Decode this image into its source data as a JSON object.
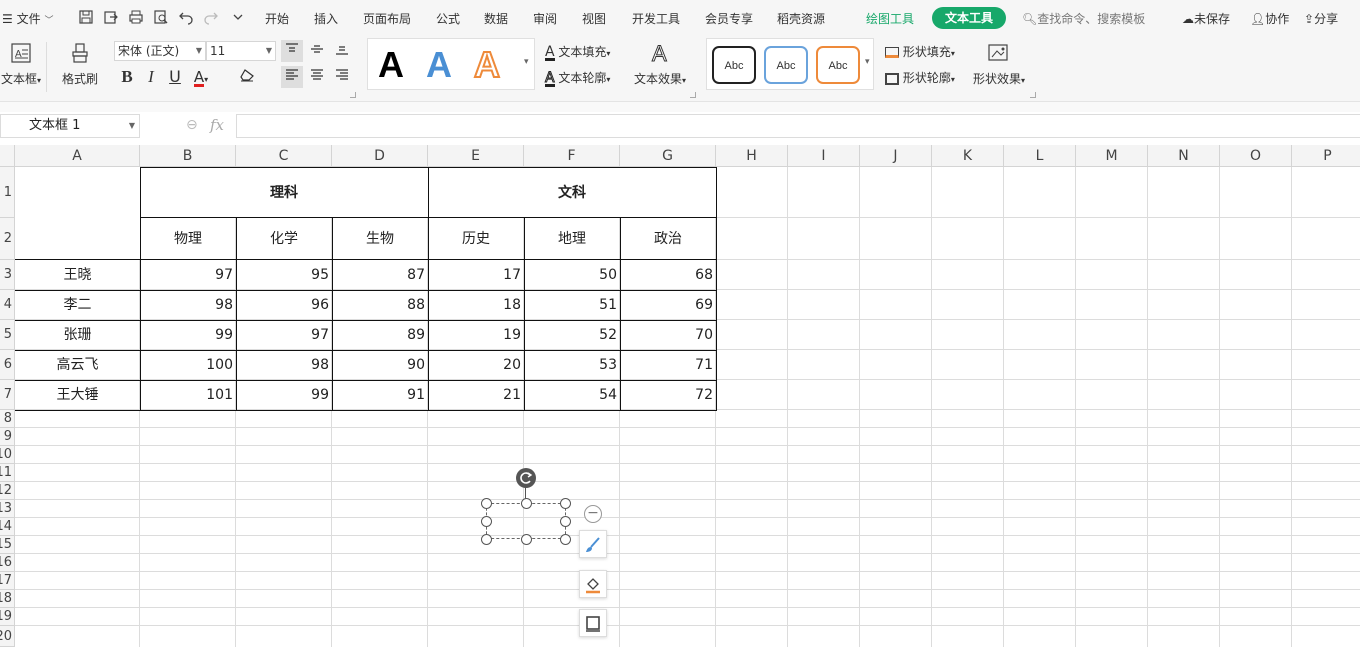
{
  "menu": {
    "file": "文件",
    "tabs": [
      "开始",
      "插入",
      "页面布局",
      "公式",
      "数据",
      "审阅",
      "视图",
      "开发工具",
      "会员专享",
      "稻壳资源"
    ],
    "ctx_draw": "绘图工具",
    "ctx_text": "文本工具",
    "search_placeholder": "查找命令、搜索模板",
    "unsaved": "未保存",
    "collab": "协作",
    "share": "分享"
  },
  "ribbon": {
    "textbox": "文本框",
    "format_painter": "格式刷",
    "font_name": "宋体 (正文)",
    "font_size": "11",
    "bold": "B",
    "italic": "I",
    "underline": "U",
    "fontcolor": "A",
    "style_letter": "A",
    "text_fill": "文本填充",
    "text_outline": "文本轮廓",
    "text_effects": "文本效果",
    "abc": "Abc",
    "shape_fill": "形状填充",
    "shape_outline": "形状轮廓",
    "shape_effects": "形状效果",
    "accent_blue": "#4a8fd4",
    "accent_orange": "#ee8a3a",
    "accent_green": "#17a86a"
  },
  "formula_bar": {
    "name_box": "文本框 1",
    "fx": "fx"
  },
  "columns": [
    "A",
    "B",
    "C",
    "D",
    "E",
    "F",
    "G",
    "H",
    "I",
    "J",
    "K",
    "L",
    "M",
    "N",
    "O",
    "P"
  ],
  "rows": [
    "1",
    "2",
    "3",
    "4",
    "5",
    "6",
    "7",
    "8",
    "9",
    "10",
    "11",
    "12",
    "13",
    "14",
    "15",
    "16",
    "17",
    "18",
    "19",
    "20"
  ],
  "table": {
    "group_science": "理科",
    "group_arts": "文科",
    "subjects": [
      "物理",
      "化学",
      "生物",
      "历史",
      "地理",
      "政治"
    ],
    "students": [
      {
        "name": "王晓",
        "scores": [
          "97",
          "95",
          "87",
          "17",
          "50",
          "68"
        ]
      },
      {
        "name": "李二",
        "scores": [
          "98",
          "96",
          "88",
          "18",
          "51",
          "69"
        ]
      },
      {
        "name": "张珊",
        "scores": [
          "99",
          "97",
          "89",
          "19",
          "52",
          "70"
        ]
      },
      {
        "name": "高云飞",
        "scores": [
          "100",
          "98",
          "90",
          "20",
          "53",
          "71"
        ]
      },
      {
        "name": "王大锤",
        "scores": [
          "101",
          "99",
          "91",
          "21",
          "54",
          "72"
        ]
      }
    ]
  },
  "icons": {
    "rotate": "rotate-icon",
    "minus": "collapse-icon",
    "brush": "brush-icon",
    "fill": "fill-bucket-icon",
    "outline": "outline-icon"
  }
}
